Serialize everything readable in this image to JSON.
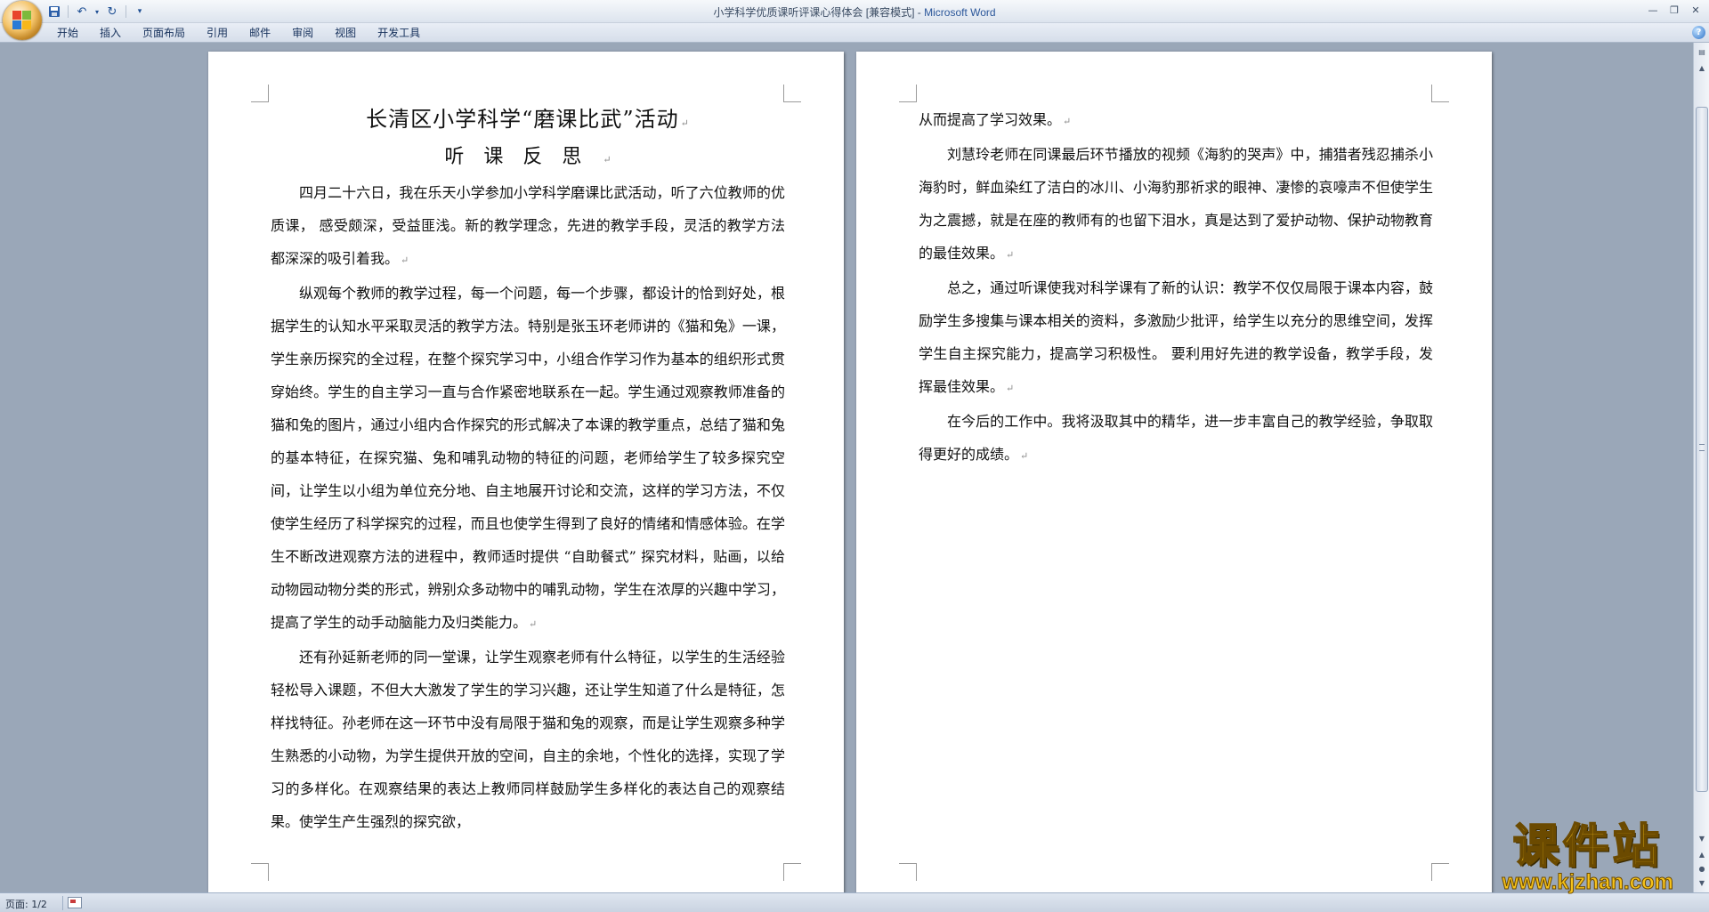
{
  "window": {
    "title_doc": "小学科学优质课听评课心得体会 [兼容模式]",
    "title_sep": " - ",
    "title_app": "Microsoft Word"
  },
  "ribbon": {
    "tabs": [
      "开始",
      "插入",
      "页面布局",
      "引用",
      "邮件",
      "审阅",
      "视图",
      "开发工具"
    ]
  },
  "page1": {
    "title": "长清区小学科学“磨课比武”活动",
    "subtitle": "听课反思",
    "paragraphs": [
      "四月二十六日，我在乐天小学参加小学科学磨课比武活动，听了六位教师的优质课，  感受颇深，受益匪浅。新的教学理念，先进的教学手段，灵活的教学方法都深深的吸引着我。",
      "纵观每个教师的教学过程，每一个问题，每一个步骤，都设计的恰到好处，根据学生的认知水平采取灵活的教学方法。特别是张玉环老师讲的《猫和兔》一课，学生亲历探究的全过程，在整个探究学习中，小组合作学习作为基本的组织形式贯穿始终。学生的自主学习一直与合作紧密地联系在一起。学生通过观察教师准备的猫和兔的图片，通过小组内合作探究的形式解决了本课的教学重点，总结了猫和兔的基本特征，在探究猫、兔和哺乳动物的特征的问题，老师给学生了较多探究空间，让学生以小组为单位充分地、自主地展开讨论和交流，这样的学习方法，不仅使学生经历了科学探究的过程，而且也使学生得到了良好的情绪和情感体验。在学生不断改进观察方法的进程中，教师适时提供 “自助餐式” 探究材料，贴画，以给动物园动物分类的形式，辨别众多动物中的哺乳动物，学生在浓厚的兴趣中学习，提高了学生的动手动脑能力及归类能力。",
      "还有孙延新老师的同一堂课，让学生观察老师有什么特征，以学生的生活经验轻松导入课题，不但大大激发了学生的学习兴趣，还让学生知道了什么是特征，怎样找特征。孙老师在这一环节中没有局限于猫和兔的观察，而是让学生观察多种学生熟悉的小动物，为学生提供开放的空间，自主的余地，个性化的选择，实现了学习的多样化。在观察结果的表达上教师同样鼓励学生多样化的表达自己的观察结果。使学生产生强烈的探究欲，"
    ]
  },
  "page2": {
    "paragraphs": [
      "从而提高了学习效果。",
      "刘慧玲老师在同课最后环节播放的视频《海豹的哭声》中，捕猎者残忍捕杀小海豹时，鲜血染红了洁白的冰川、小海豹那祈求的眼神、凄惨的哀嚎声不但使学生为之震撼，就是在座的教师有的也留下泪水，真是达到了爱护动物、保护动物教育的最佳效果。",
      "总之，通过听课使我对科学课有了新的认识：教学不仅仅局限于课本内容，鼓励学生多搜集与课本相关的资料，多激励少批评，给学生以充分的思维空间，发挥学生自主探究能力，提高学习积极性。 要利用好先进的教学设备，教学手段，发挥最佳效果。",
      "在今后的工作中。我将汲取其中的精华，进一步丰富自己的教学经验，争取取得更好的成绩。"
    ]
  },
  "paragraph_mark": "↵",
  "status": {
    "page": "页面: 1/2"
  },
  "watermark": {
    "brand": "课件站",
    "url": "www.kjzhan.com"
  },
  "icons": {
    "office_button": "office-logo-icon",
    "save": "save-icon",
    "undo": "undo-icon",
    "redo": "redo-icon",
    "customize": "customize-qat-icon",
    "help": "help-icon"
  }
}
